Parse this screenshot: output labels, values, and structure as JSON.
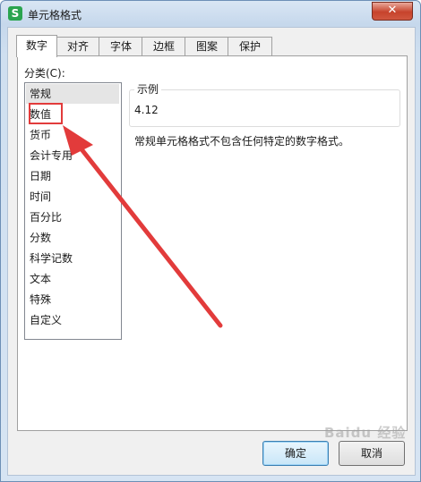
{
  "window": {
    "title": "单元格格式",
    "app_icon": "S",
    "close_glyph": "✕"
  },
  "tabs": [
    {
      "label": "数字",
      "active": true
    },
    {
      "label": "对齐"
    },
    {
      "label": "字体"
    },
    {
      "label": "边框"
    },
    {
      "label": "图案"
    },
    {
      "label": "保护"
    }
  ],
  "category": {
    "label": "分类(C):",
    "items": [
      "常规",
      "数值",
      "货币",
      "会计专用",
      "日期",
      "时间",
      "百分比",
      "分数",
      "科学记数",
      "文本",
      "特殊",
      "自定义"
    ],
    "selected": "常规",
    "highlighted": "数值"
  },
  "sample": {
    "legend": "示例",
    "value": "4.12"
  },
  "description": "常规单元格格式不包含任何特定的数字格式。",
  "buttons": {
    "ok": "确定",
    "cancel": "取消"
  },
  "watermark": "Baidu 经验",
  "colors": {
    "annotation": "#e23b3b",
    "selection": "#e5e5e5",
    "title_bar": "#c6d8ec"
  }
}
